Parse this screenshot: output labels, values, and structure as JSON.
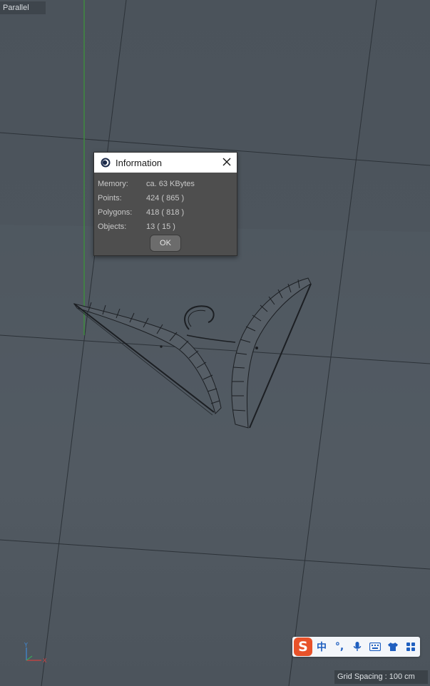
{
  "viewport": {
    "view_label": "Parallel",
    "grid_spacing_text": "Grid Spacing : 100 cm"
  },
  "axis_gizmo": {
    "y_label": "Y",
    "x_label": "X"
  },
  "info_dialog": {
    "title": "Information",
    "app_icon": "cinema4d-logo-icon",
    "close_icon": "close-icon",
    "rows": [
      {
        "label": "Memory:",
        "value": "ca. 63 KBytes"
      },
      {
        "label": "Points:",
        "value": "424 ( 865 )"
      },
      {
        "label": "Polygons:",
        "value": "418 ( 818 )"
      },
      {
        "label": "Objects:",
        "value": "13 ( 15 )"
      }
    ],
    "ok_label": "OK"
  },
  "ime_toolbar": {
    "logo_letter": "S",
    "mode_label": "中",
    "punct_label": "°,",
    "icons": [
      "microphone-icon",
      "keyboard-icon",
      "shirt-icon",
      "grid-apps-icon"
    ],
    "brand_color": "#e8522a",
    "icon_color": "#1f5fbf"
  }
}
